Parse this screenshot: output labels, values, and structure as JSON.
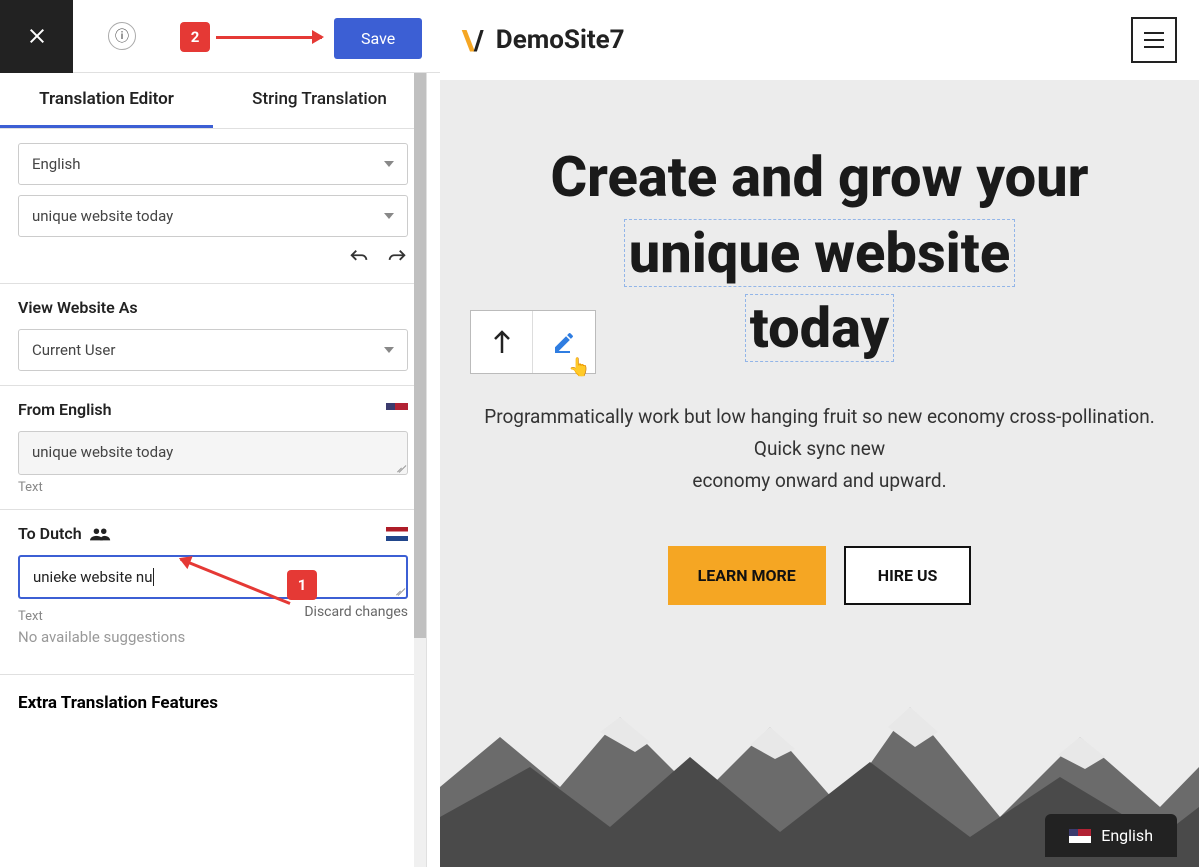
{
  "topbar": {
    "save_label": "Save",
    "callout_2": "2"
  },
  "tabs": {
    "translation_editor": "Translation Editor",
    "string_translation": "String Translation"
  },
  "selectors": {
    "language": "English",
    "string": "unique website today"
  },
  "view_as": {
    "label": "View Website As",
    "value": "Current User"
  },
  "from": {
    "label": "From English",
    "value": "unique website today",
    "type": "Text"
  },
  "to": {
    "label": "To Dutch",
    "value": "unieke website nu",
    "type": "Text",
    "discard": "Discard changes",
    "callout_1": "1"
  },
  "suggestions": "No available suggestions",
  "extra": "Extra Translation Features",
  "site": {
    "title": "DemoSite7",
    "hero_line1": "Create and grow your",
    "hero_line2": "unique website",
    "hero_line3": "today",
    "desc1": "Programmatically work but low hanging fruit so new economy cross-pollination.",
    "desc2": "Quick sync new",
    "desc3": "economy onward and upward.",
    "learn_more": "LEARN MORE",
    "hire_us": "HIRE US",
    "lang": "English"
  }
}
